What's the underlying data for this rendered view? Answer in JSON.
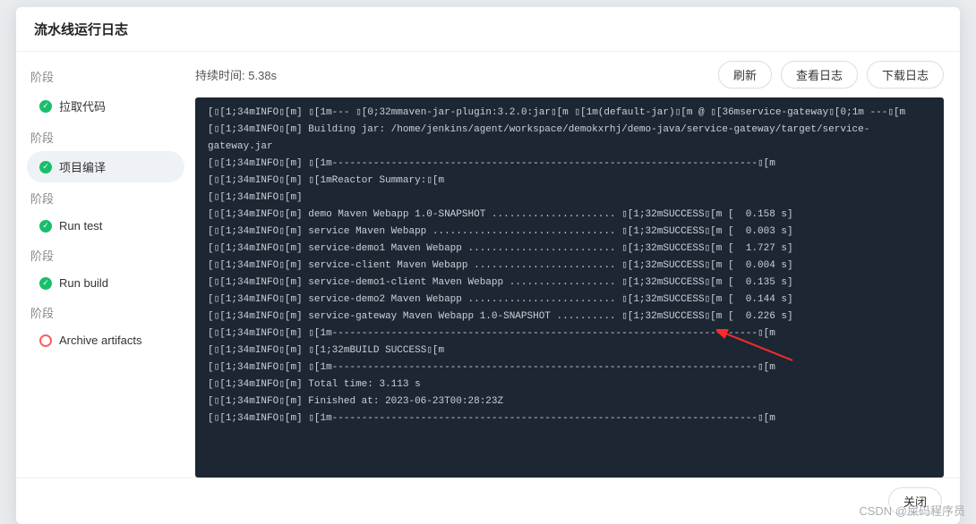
{
  "modal": {
    "title": "流水线运行日志"
  },
  "sidebar": {
    "stages": [
      {
        "label": "阶段",
        "item": "拉取代码",
        "status": "success"
      },
      {
        "label": "阶段",
        "item": "项目编译",
        "status": "success",
        "active": true
      },
      {
        "label": "阶段",
        "item": "Run test",
        "status": "success"
      },
      {
        "label": "阶段",
        "item": "Run build",
        "status": "success"
      },
      {
        "label": "阶段",
        "item": "Archive artifacts",
        "status": "pending"
      }
    ]
  },
  "content": {
    "duration_label": "持续时间:",
    "duration_value": "5.38s",
    "actions": {
      "refresh": "刷新",
      "view_log": "查看日志",
      "download": "下载日志"
    }
  },
  "log_lines": [
    "[▯[1;34mINFO▯[m] ▯[1m--- ▯[0;32mmaven-jar-plugin:3.2.0:jar▯[m ▯[1m(default-jar)▯[m @ ▯[36mservice-gateway▯[0;1m ---▯[m",
    "[▯[1;34mINFO▯[m] Building jar: /home/jenkins/agent/workspace/demokxrhj/demo-java/service-gateway/target/service-",
    "gateway.jar",
    "[▯[1;34mINFO▯[m] ▯[1m------------------------------------------------------------------------▯[m",
    "[▯[1;34mINFO▯[m] ▯[1mReactor Summary:▯[m",
    "[▯[1;34mINFO▯[m]",
    "[▯[1;34mINFO▯[m] demo Maven Webapp 1.0-SNAPSHOT ..................... ▯[1;32mSUCCESS▯[m [  0.158 s]",
    "[▯[1;34mINFO▯[m] service Maven Webapp ............................... ▯[1;32mSUCCESS▯[m [  0.003 s]",
    "[▯[1;34mINFO▯[m] service-demo1 Maven Webapp ......................... ▯[1;32mSUCCESS▯[m [  1.727 s]",
    "[▯[1;34mINFO▯[m] service-client Maven Webapp ........................ ▯[1;32mSUCCESS▯[m [  0.004 s]",
    "[▯[1;34mINFO▯[m] service-demo1-client Maven Webapp .................. ▯[1;32mSUCCESS▯[m [  0.135 s]",
    "[▯[1;34mINFO▯[m] service-demo2 Maven Webapp ......................... ▯[1;32mSUCCESS▯[m [  0.144 s]",
    "[▯[1;34mINFO▯[m] service-gateway Maven Webapp 1.0-SNAPSHOT .......... ▯[1;32mSUCCESS▯[m [  0.226 s]",
    "[▯[1;34mINFO▯[m] ▯[1m------------------------------------------------------------------------▯[m",
    "[▯[1;34mINFO▯[m] ▯[1;32mBUILD SUCCESS▯[m",
    "[▯[1;34mINFO▯[m] ▯[1m------------------------------------------------------------------------▯[m",
    "[▯[1;34mINFO▯[m] Total time: 3.113 s",
    "[▯[1;34mINFO▯[m] Finished at: 2023-06-23T00:28:23Z",
    "[▯[1;34mINFO▯[m] ▯[1m------------------------------------------------------------------------▯[m"
  ],
  "footer": {
    "close": "关闭"
  },
  "watermark": "CSDN @屎码程序员"
}
